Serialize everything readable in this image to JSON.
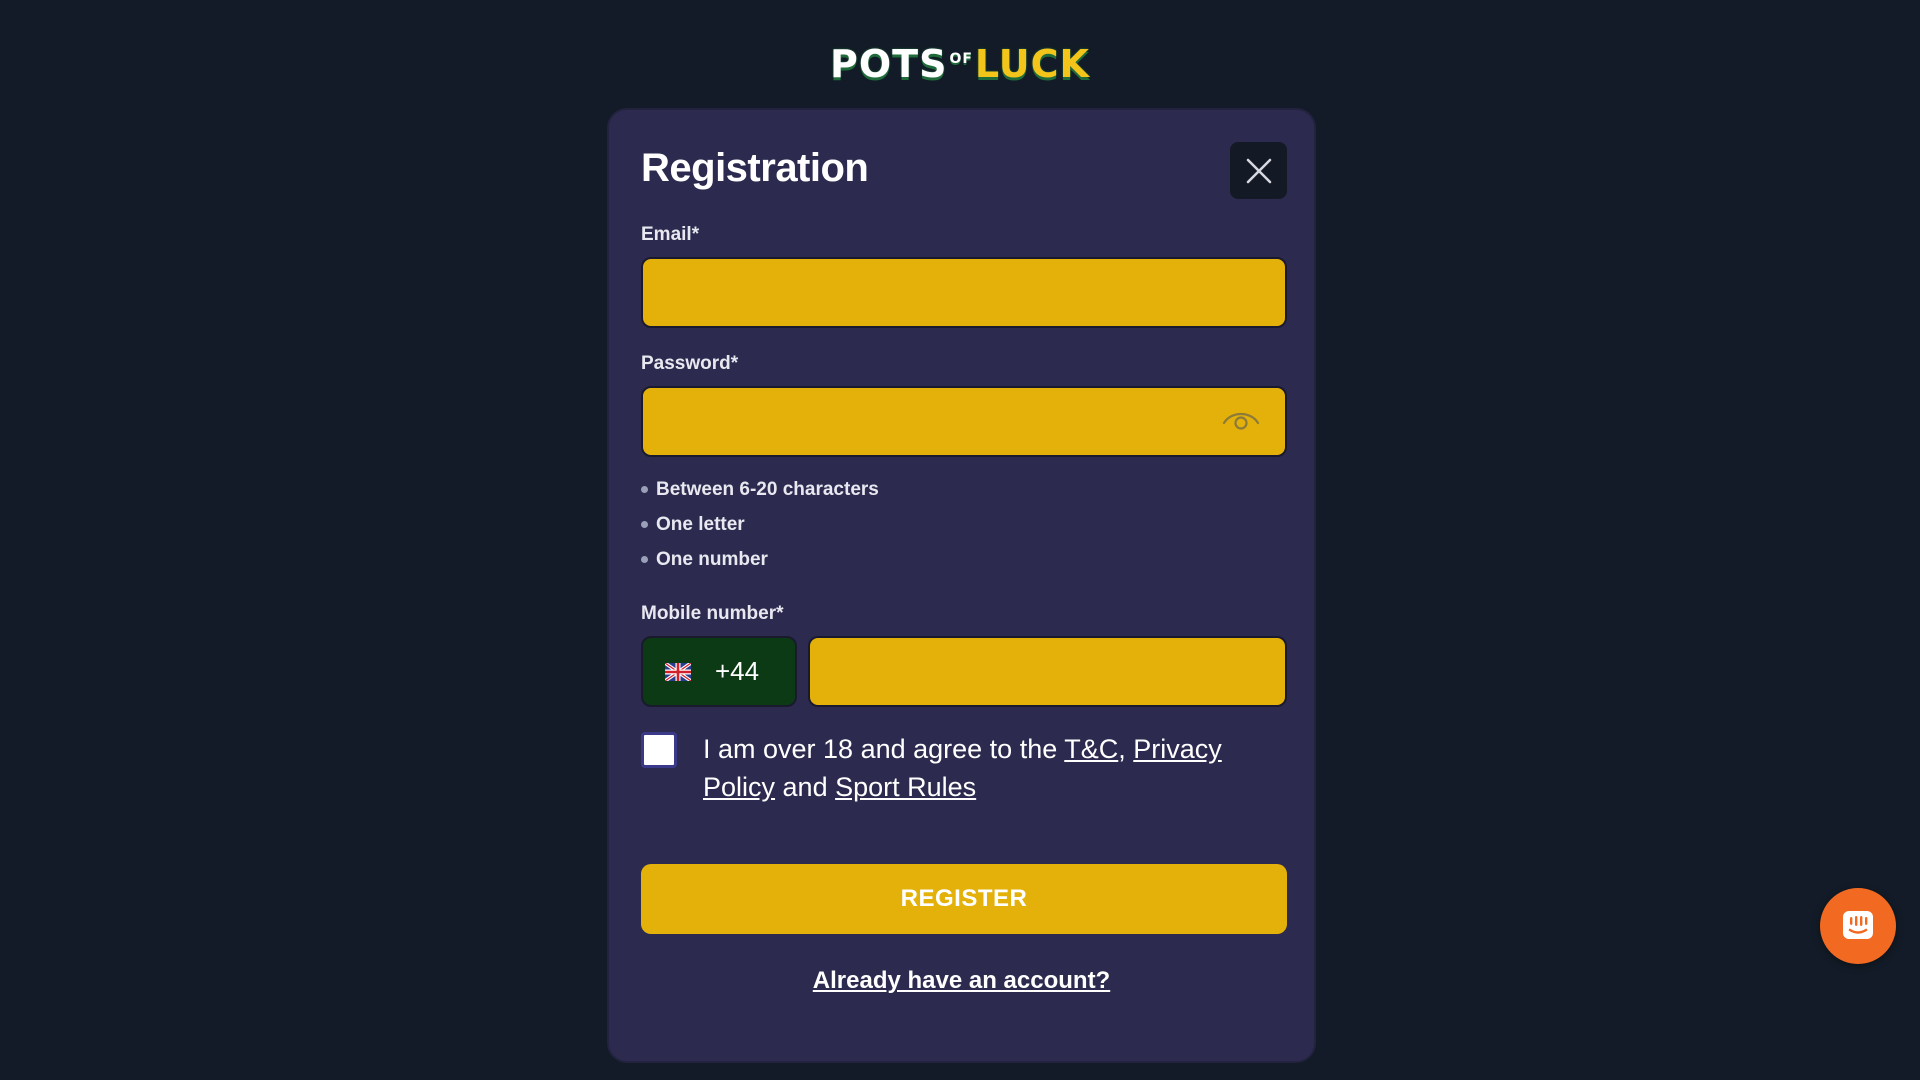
{
  "brand": {
    "logo_part1": "POTS",
    "logo_part2": "OF",
    "logo_part3": "LUCK",
    "accent_color": "#e3b10a"
  },
  "modal": {
    "title": "Registration",
    "close_icon": "close-icon"
  },
  "email": {
    "label": "Email*",
    "value": "",
    "placeholder": ""
  },
  "password": {
    "label": "Password*",
    "value": "",
    "placeholder": "",
    "toggle_icon": "eye-icon",
    "rules": [
      "Between 6-20 characters",
      "One letter",
      "One number"
    ]
  },
  "mobile": {
    "label": "Mobile number*",
    "country_flag_icon": "uk-flag-icon",
    "country_code": "+44",
    "value": "",
    "placeholder": ""
  },
  "agreement": {
    "checked": false,
    "text_prefix": "I am over 18 and agree to the ",
    "link_tc": "T&C",
    "separator": ", ",
    "link_privacy": "Privacy Policy",
    "text_and": " and ",
    "link_sport_rules": "Sport Rules"
  },
  "register_button": "REGISTER",
  "login_link": "Already have an account?",
  "chat_widget": {
    "icon": "chat-icon",
    "color": "#f26a21"
  }
}
